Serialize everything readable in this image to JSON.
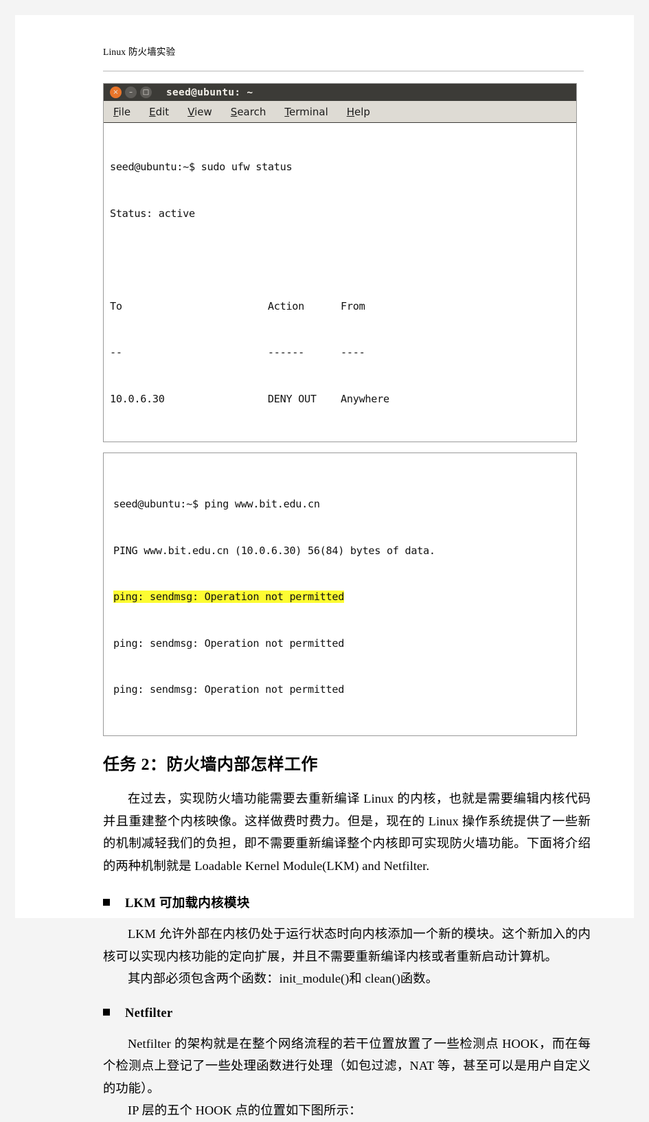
{
  "document": {
    "header": "Linux 防火墙实验"
  },
  "terminal1": {
    "title": "seed@ubuntu: ~",
    "buttons": {
      "close": "×",
      "minimize": "–",
      "maximize": "□"
    },
    "menu": [
      {
        "mnemonic": "F",
        "rest": "ile"
      },
      {
        "mnemonic": "E",
        "rest": "dit"
      },
      {
        "mnemonic": "V",
        "rest": "iew"
      },
      {
        "mnemonic": "S",
        "rest": "earch"
      },
      {
        "mnemonic": "T",
        "rest": "erminal"
      },
      {
        "mnemonic": "H",
        "rest": "elp"
      }
    ],
    "lines": [
      "seed@ubuntu:~$ sudo ufw status",
      "Status: active",
      "",
      "To                        Action      From",
      "--                        ------      ----",
      "10.0.6.30                 DENY OUT    Anywhere"
    ]
  },
  "terminal2": {
    "lines": [
      {
        "text": "seed@ubuntu:~$ ping www.bit.edu.cn",
        "highlight": false
      },
      {
        "text": "PING www.bit.edu.cn (10.0.6.30) 56(84) bytes of data.",
        "highlight": false
      },
      {
        "text": "ping: sendmsg: Operation not permitted",
        "highlight": true
      },
      {
        "text": "ping: sendmsg: Operation not permitted",
        "highlight": false
      },
      {
        "text": "ping: sendmsg: Operation not permitted",
        "highlight": false
      }
    ],
    "highlight_color": "#fdfc32"
  },
  "content": {
    "section_title": "任务 2：防火墙内部怎样工作",
    "intro_paragraph": "在过去，实现防火墙功能需要去重新编译 Linux 的内核，也就是需要编辑内核代码并且重建整个内核映像。这样做费时费力。但是，现在的 Linux 操作系统提供了一些新的机制减轻我们的负担，即不需要重新编译整个内核即可实现防火墙功能。下面将介绍的两种机制就是 Loadable Kernel Module(LKM) and Netfilter.",
    "lkm": {
      "bullet_label": "LKM 可加载内核模块",
      "paragraph1": "LKM 允许外部在内核仍处于运行状态时向内核添加一个新的模块。这个新加入的内核可以实现内核功能的定向扩展，并且不需要重新编译内核或者重新启动计算机。",
      "paragraph2": "其内部必须包含两个函数：init_module()和 clean()函数。"
    },
    "netfilter": {
      "bullet_label": "Netfilter",
      "paragraph1": "Netfilter 的架构就是在整个网络流程的若干位置放置了一些检测点 HOOK，而在每个检测点上登记了一些处理函数进行处理（如包过滤，NAT 等，甚至可以是用户自定义的功能）。",
      "paragraph2": "IP 层的五个 HOOK 点的位置如下图所示："
    }
  }
}
